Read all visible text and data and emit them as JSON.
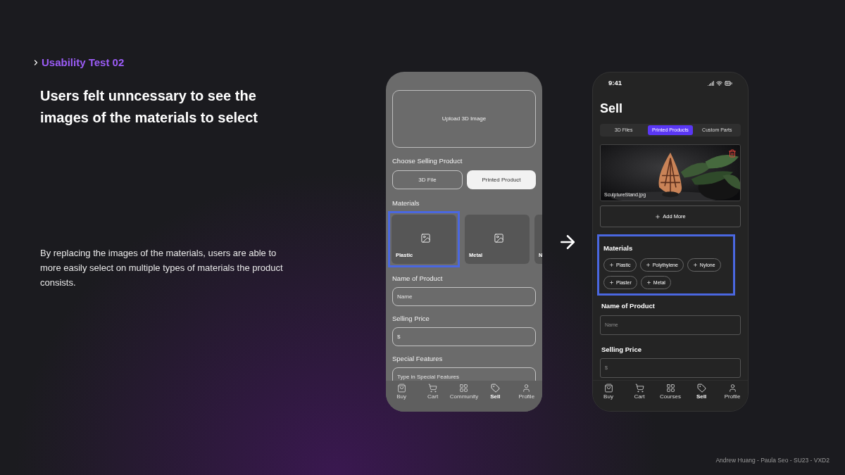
{
  "heading": {
    "title": "Usability Test 02"
  },
  "headline": "Users felt unncessary to see the images of the materials to select",
  "description": "By replacing the images of the materials, users are able to more easily select on multiple types of materials the product consists.",
  "before_screen": {
    "upload_label": "Upload 3D Image",
    "product_label": "Choose Selling Product",
    "product_options": [
      {
        "label": "3D File",
        "selected": false
      },
      {
        "label": "Printed Product",
        "selected": true
      }
    ],
    "materials_label": "Materials",
    "materials": [
      {
        "label": "Plastic",
        "highlighted": true
      },
      {
        "label": "Metal",
        "highlighted": false
      },
      {
        "label": "N",
        "highlighted": false
      }
    ],
    "fields": [
      {
        "label": "Name of Product",
        "placeholder": "Name"
      },
      {
        "label": "Selling Price",
        "placeholder": "$"
      },
      {
        "label": "Special Features",
        "placeholder": "Type in Special Features"
      }
    ],
    "nav": [
      {
        "label": "Buy",
        "selected": false
      },
      {
        "label": "Cart",
        "selected": false
      },
      {
        "label": "Community",
        "selected": false
      },
      {
        "label": "Sell",
        "selected": true
      },
      {
        "label": "Profile",
        "selected": false
      }
    ]
  },
  "after_screen": {
    "time": "9:41",
    "title": "Sell",
    "tabs": [
      {
        "label": "3D Files",
        "selected": false
      },
      {
        "label": "Printed Products",
        "selected": true
      },
      {
        "label": "Custom Parts",
        "selected": false
      }
    ],
    "photo": {
      "kind": "picture",
      "caption": "SculptureStand.jpg"
    },
    "add_more": "Add More",
    "materials": {
      "label": "Materials",
      "highlighted": true,
      "chips": [
        "Plastic",
        "Polythylene",
        "Nylone",
        "Plaster",
        "Metal"
      ]
    },
    "fields": [
      {
        "label": "Name of Product",
        "placeholder": "Name"
      },
      {
        "label": "Selling Price",
        "placeholder": "$"
      }
    ],
    "nav": [
      {
        "label": "Buy",
        "selected": false
      },
      {
        "label": "Cart",
        "selected": false
      },
      {
        "label": "Courses",
        "selected": false
      },
      {
        "label": "Sell",
        "selected": true
      },
      {
        "label": "Profile",
        "selected": false
      }
    ]
  },
  "footer": "Andrew Huang - Paula Seo - SU23 - VXD2"
}
